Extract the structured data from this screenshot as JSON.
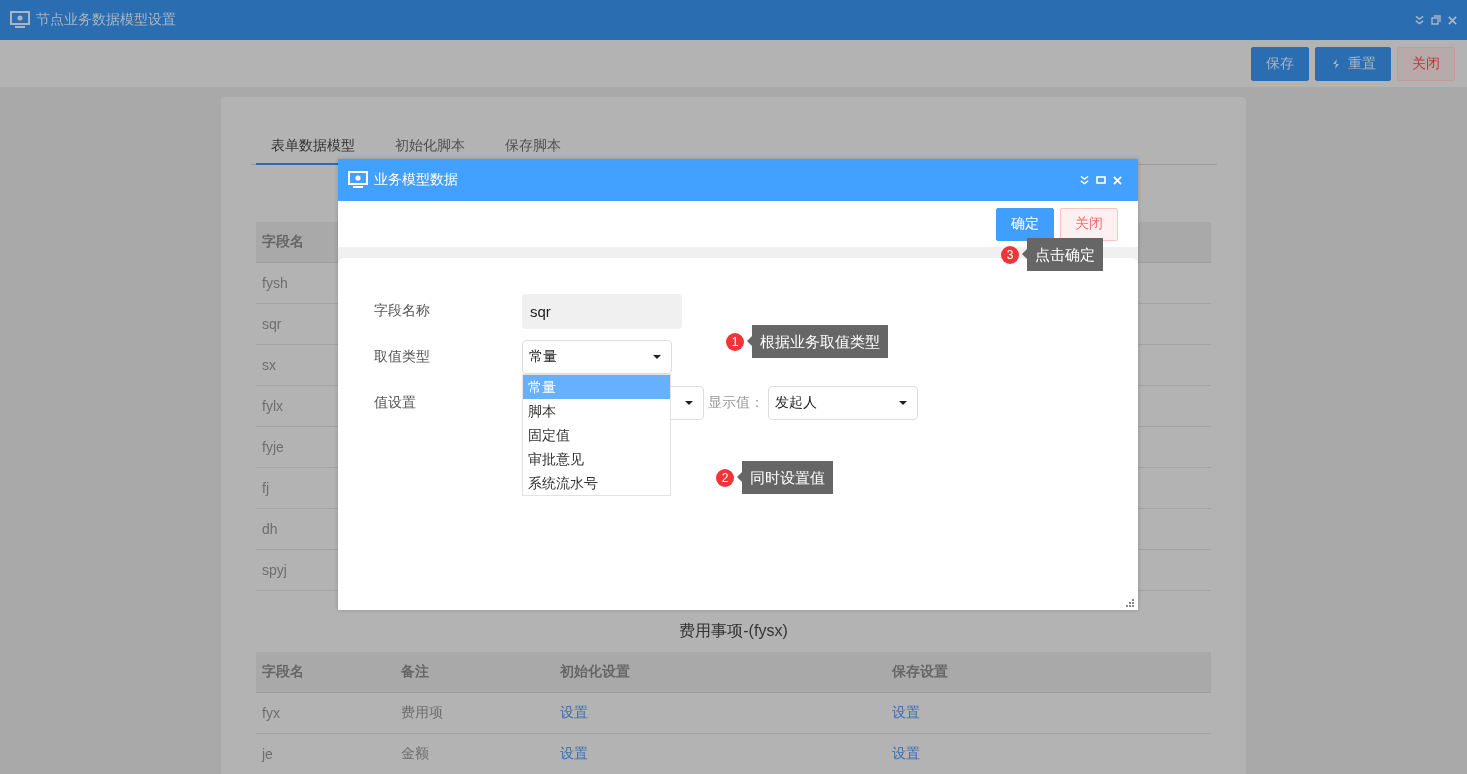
{
  "window": {
    "title": "节点业务数据模型设置"
  },
  "toolbar": {
    "buttons": [
      {
        "label": "保存",
        "kind": "primary"
      },
      {
        "label": "重置",
        "kind": "reset"
      },
      {
        "label": "关闭",
        "kind": "danger"
      }
    ]
  },
  "tabs": [
    {
      "label": "表单数据模型",
      "selected": true
    },
    {
      "label": "初始化脚本",
      "selected": false
    },
    {
      "label": "保存脚本",
      "selected": false
    }
  ],
  "field_table": {
    "columns": [
      "字段名"
    ],
    "rows": [
      "fysh",
      "sqr",
      "sx",
      "fylx",
      "fyje",
      "fj",
      "dh",
      "spyj"
    ]
  },
  "section": {
    "title": "费用事项-(fysx)",
    "columns": [
      "字段名",
      "备注",
      "初始化设置",
      "保存设置"
    ],
    "rows": [
      {
        "field": "fyx",
        "note": "费用项",
        "init": "设置",
        "save": "设置"
      },
      {
        "field": "je",
        "note": "金额",
        "init": "设置",
        "save": "设置"
      }
    ]
  },
  "dialog": {
    "title": "业务模型数据",
    "buttons": [
      {
        "label": "确定",
        "kind": "primary"
      },
      {
        "label": "关闭",
        "kind": "danger"
      }
    ],
    "field_name": {
      "label": "字段名称",
      "value": "sqr"
    },
    "value_type": {
      "label": "取值类型",
      "value": "常量",
      "expanded": true,
      "options": [
        {
          "label": "常量",
          "selected": true
        },
        {
          "label": "脚本",
          "selected": false
        },
        {
          "label": "固定值",
          "selected": false
        },
        {
          "label": "审批意见",
          "selected": false
        },
        {
          "label": "系统流水号",
          "selected": false
        }
      ]
    },
    "value_setting": {
      "label": "值设置",
      "display_label": "显示值：",
      "display_value": "发起人"
    }
  },
  "annotations": [
    {
      "number": "1",
      "text": "根据业务取值类型"
    },
    {
      "number": "2",
      "text": "同时设置值"
    },
    {
      "number": "3",
      "text": "点击确定"
    }
  ]
}
